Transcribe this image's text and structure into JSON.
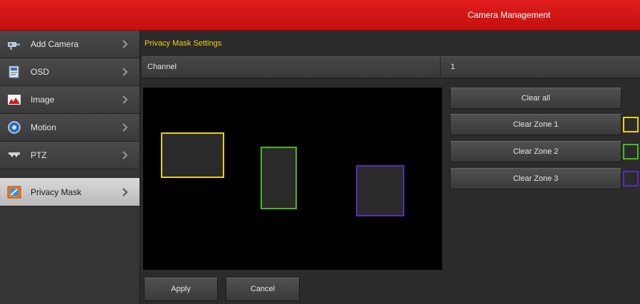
{
  "window": {
    "title": "Camera Management"
  },
  "sidebar": {
    "items": [
      {
        "label": "Add Camera",
        "icon": "add-camera-icon"
      },
      {
        "label": "OSD",
        "icon": "osd-icon"
      },
      {
        "label": "Image",
        "icon": "image-icon"
      },
      {
        "label": "Motion",
        "icon": "motion-icon"
      },
      {
        "label": "PTZ",
        "icon": "ptz-icon"
      },
      {
        "label": "Privacy Mask",
        "icon": "privacy-mask-icon",
        "active": true
      }
    ]
  },
  "main": {
    "section_title": "Privacy Mask Settings",
    "channel": {
      "label": "Channel",
      "value": "1"
    },
    "buttons": {
      "clear_all": "Clear all",
      "clear_zone_1": "Clear Zone 1",
      "clear_zone_2": "Clear Zone 2",
      "clear_zone_3": "Clear Zone 3",
      "apply": "Apply",
      "cancel": "Cancel"
    },
    "zones": [
      {
        "id": 1,
        "color": "#e6d11a"
      },
      {
        "id": 2,
        "color": "#48b81a"
      },
      {
        "id": 3,
        "color": "#5a2ab8"
      }
    ]
  },
  "colors": {
    "titlebar": "#d01515",
    "section_title": "#f2d11c",
    "active_item": "#cfcfcf"
  }
}
